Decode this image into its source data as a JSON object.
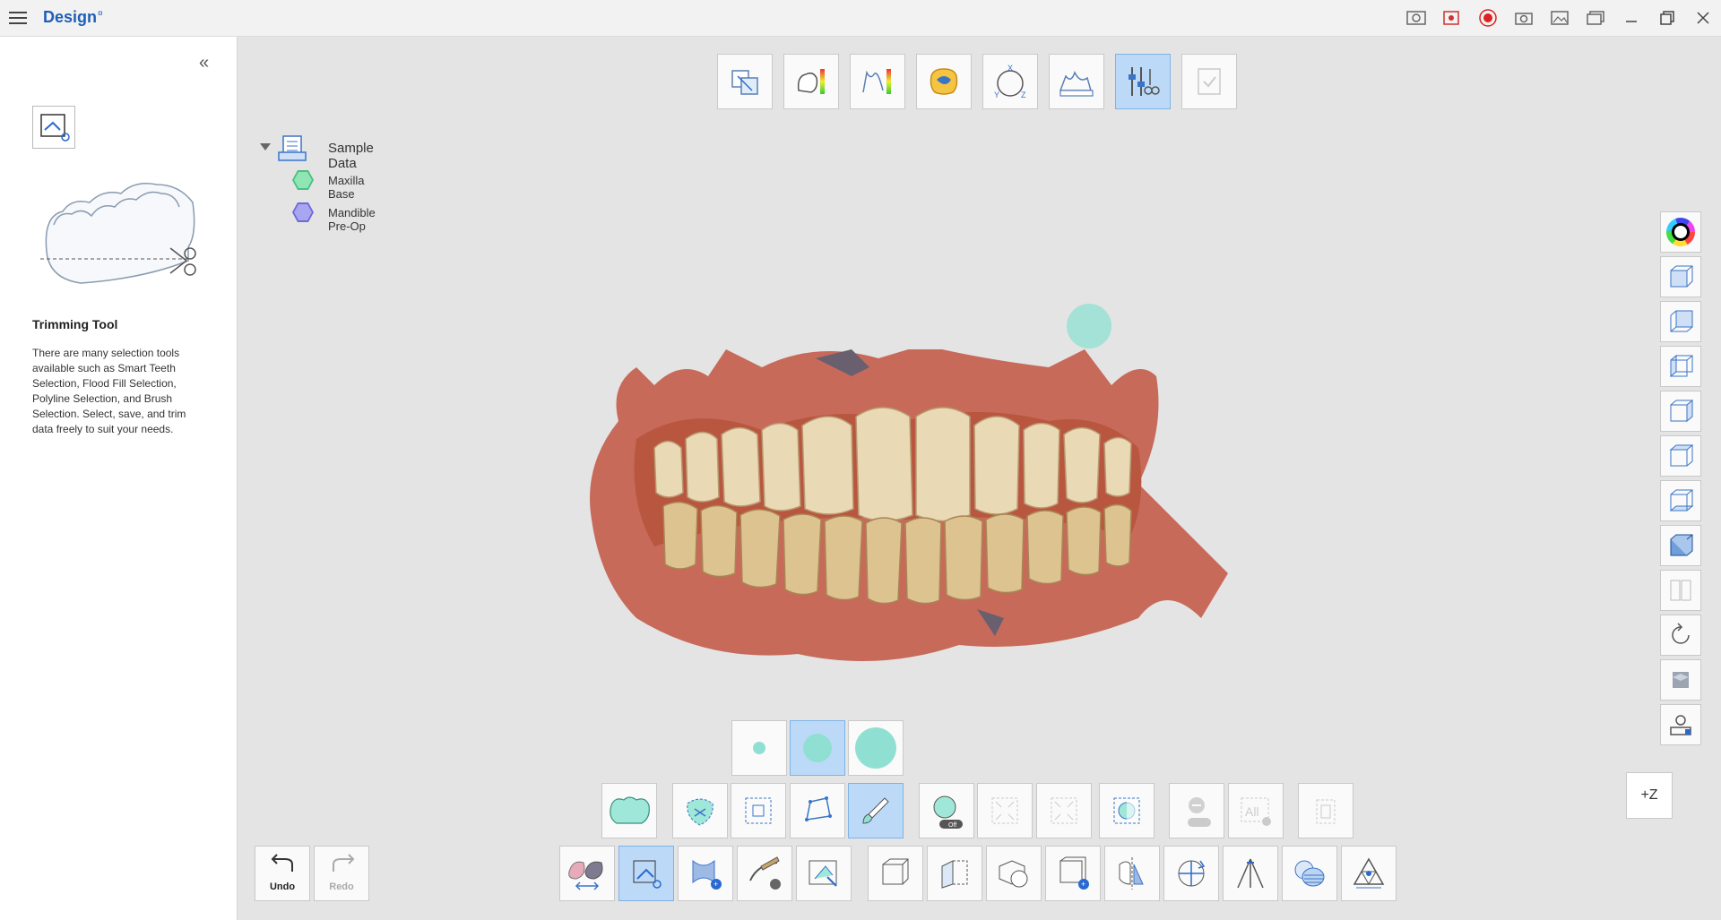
{
  "app": {
    "title": "Design",
    "title_sup": "¤"
  },
  "sidebar": {
    "title": "Trimming Tool",
    "description": "There are many selection tools available such as Smart Teeth Selection, Flood Fill Selection, Polyline Selection, and Brush Selection. Select, save, and trim data freely to suit your needs."
  },
  "tree": {
    "root": "Sample Data",
    "items": [
      {
        "label": "Maxilla Base",
        "color": "#8fe6b4",
        "border": "#4bbf7f"
      },
      {
        "label": "Mandible Pre-Op",
        "color": "#a9a6f1",
        "border": "#6e6ad6"
      }
    ]
  },
  "history": {
    "undo": "Undo",
    "redo": "Redo"
  },
  "view": {
    "axis_label": "+Z"
  },
  "colors": {
    "accent": "#1e5fb8",
    "active_bg": "#bcdaf8",
    "selection": "#8fe0d2"
  }
}
